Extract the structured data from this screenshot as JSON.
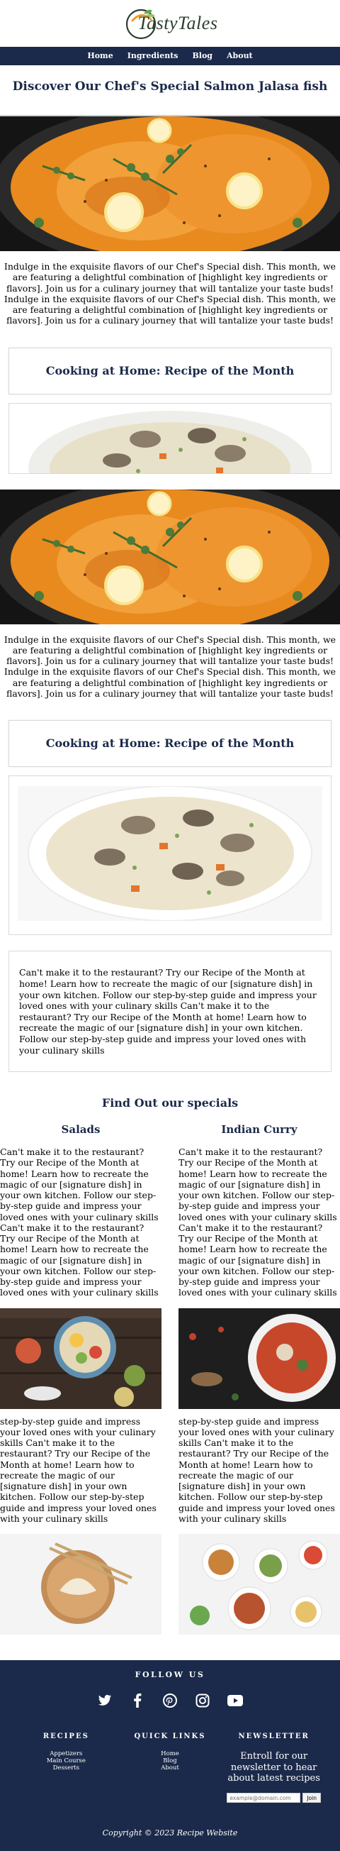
{
  "brand": {
    "name": "TastyTales"
  },
  "nav": {
    "items": [
      "Home",
      "Ingredients",
      "Blog",
      "About"
    ]
  },
  "hero": {
    "title": "Discover Our Chef's Special Salmon Jalasa fish",
    "paragraph": "Indulge in the exquisite flavors of our Chef's Special dish. This month, we are featuring a delightful combination of [highlight key ingredients or flavors]. Join us for a culinary journey that will tantalize your taste buds! Indulge in the exquisite flavors of our Chef's Special dish. This month, we are featuring a delightful combination of [highlight key ingredients or flavors]. Join us for a culinary journey that will tantalize your taste buds!"
  },
  "recipe": {
    "title": "Cooking at Home: Recipe of the Month",
    "text": "Can't make it to the restaurant? Try our Recipe of the Month at home! Learn how to recreate the magic of our [signature dish] in your own kitchen. Follow our step-by-step guide and impress your loved ones with your culinary skills Can't make it to the restaurant? Try our Recipe of the Month at home! Learn how to recreate the magic of our [signature dish] in your own kitchen. Follow our step-by-step guide and impress your loved ones with your culinary skills"
  },
  "specials": {
    "title": "Find Out our specials",
    "left": {
      "heading": "Salads",
      "text1": "Can't make it to the restaurant? Try our Recipe of the Month at home! Learn how to recreate the magic of our [signature dish] in your own kitchen. Follow our step-by-step guide and impress your loved ones with your culinary skills Can't make it to the restaurant? Try our Recipe of the Month at home! Learn how to recreate the magic of our [signature dish] in your own kitchen. Follow our step-by-step guide and impress your loved ones with your culinary skills",
      "text2": "step-by-step guide and impress your loved ones with your culinary skills Can't make it to the restaurant? Try our Recipe of the Month at home! Learn how to recreate the magic of our [signature dish] in your own kitchen. Follow our step-by-step guide and impress your loved ones with your culinary skills"
    },
    "right": {
      "heading": "Indian Curry",
      "text1": "Can't make it to the restaurant? Try our Recipe of the Month at home! Learn how to recreate the magic of our [signature dish] in your own kitchen. Follow our step-by-step guide and impress your loved ones with your culinary skills Can't make it to the restaurant? Try our Recipe of the Month at home! Learn how to recreate the magic of our [signature dish] in your own kitchen. Follow our step-by-step guide and impress your loved ones with your culinary skills",
      "text2": "step-by-step guide and impress your loved ones with your culinary skills Can't make it to the restaurant? Try our Recipe of the Month at home! Learn how to recreate the magic of our [signature dish] in your own kitchen. Follow our step-by-step guide and impress your loved ones with your culinary skills"
    }
  },
  "footer": {
    "follow": "FOLLOW US",
    "socials": [
      "twitter-icon",
      "facebook-icon",
      "pinterest-icon",
      "instagram-icon",
      "youtube-icon"
    ],
    "recipes": {
      "heading": "RECIPES",
      "links": [
        "Appetizers",
        "Main Course",
        "Desserts"
      ]
    },
    "quick": {
      "heading": "QUICK LINKS",
      "links": [
        "Home",
        "Blog",
        "About"
      ]
    },
    "newsletter": {
      "heading": "NEWSLETTER",
      "text": "Entroll for our newsletter to hear about latest recipes",
      "placeholder": "example@domain.com",
      "button": "Join"
    },
    "copyright": "Copyright © 2023 Recipe Website"
  },
  "colors": {
    "navy": "#1b2a4a",
    "accent": "#f39a1e"
  }
}
